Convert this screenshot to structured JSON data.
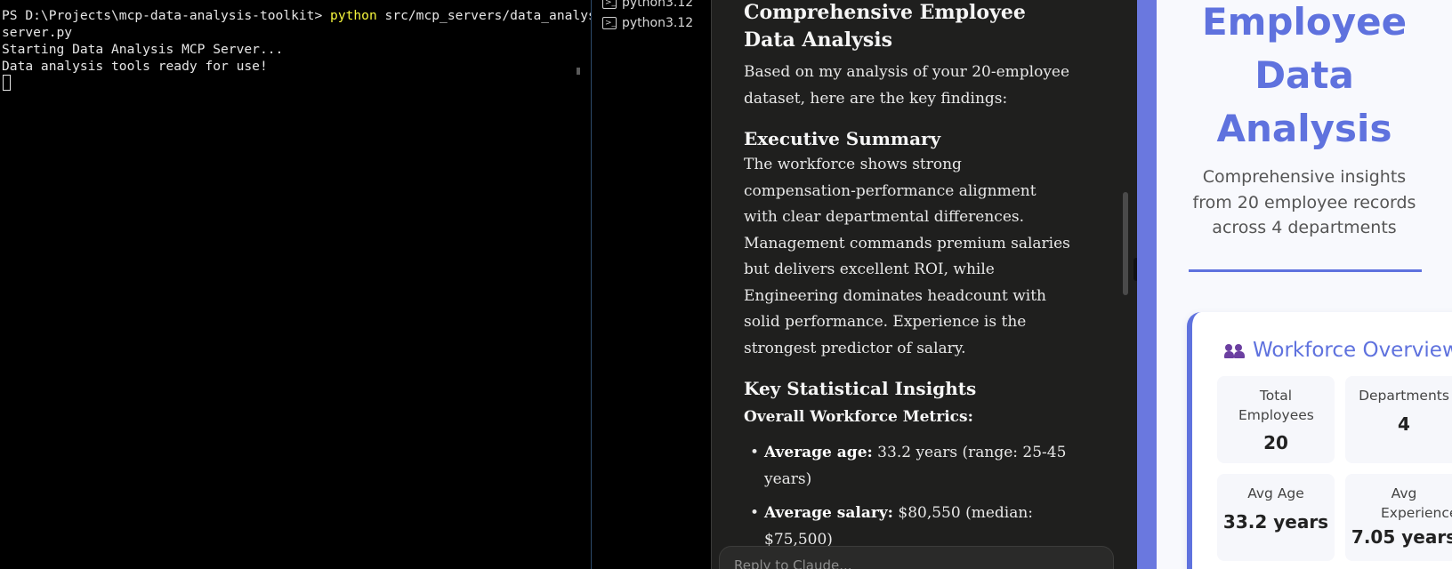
{
  "terminal": {
    "prompt": "PS D:\\Projects\\mcp-data-analysis-toolkit> ",
    "command": "python",
    "args_line1": " src/mcp_servers/data_analysis_",
    "args_line2": "server.py",
    "output": [
      "Starting Data Analysis MCP Server...",
      "Data analysis tools ready for use!"
    ]
  },
  "tablist": {
    "items": [
      {
        "label": "python3.12",
        "icon": "terminal-icon"
      },
      {
        "label": "python3.12",
        "icon": "terminal-icon"
      }
    ]
  },
  "chat": {
    "heading": "Comprehensive Employee Data Analysis",
    "intro": "Based on my analysis of your 20-employee dataset, here are the key findings:",
    "exec_heading": "Executive Summary",
    "exec_text": "The workforce shows strong compensation-performance alignment with clear departmental differences. Management commands premium salaries but delivers excellent ROI, while Engineering dominates headcount with solid performance. Experience is the strongest predictor of salary.",
    "insights_heading": "Key Statistical Insights",
    "metrics_heading": "Overall Workforce Metrics:",
    "bullets": [
      {
        "label": "Average age:",
        "text": " 33.2 years (range: 25-45 years)"
      },
      {
        "label": "Average salary:",
        "text": " $80,550 (median: $75,500)"
      }
    ],
    "input_placeholder": "Reply to Claude..."
  },
  "artifact": {
    "title_lines": [
      "Employee",
      "Data",
      "Analysis"
    ],
    "subtitle": "Comprehensive insights from 20 employee records across 4 departments",
    "card_title": "Workforce Overview",
    "card_icon": "people-icon",
    "stats": [
      {
        "label": "Total Employees",
        "value": "20"
      },
      {
        "label": "Departments",
        "value": "4"
      },
      {
        "label": "Avg Age",
        "value": "33.2 years"
      },
      {
        "label": "Avg Experience",
        "value": "7.05 years"
      }
    ]
  }
}
